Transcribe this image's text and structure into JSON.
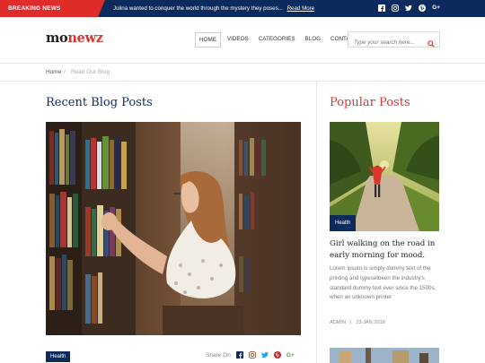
{
  "topbar": {
    "breaking_label": "BREAKING NEWS",
    "ticker_text": "Julina wanted to conquer the world through the mystery they poses...",
    "read_more": "Read More",
    "social_icons": [
      "facebook-icon",
      "instagram-icon",
      "twitter-icon",
      "pinterest-icon",
      "google-plus-icon"
    ],
    "gplus_label": "G+"
  },
  "header": {
    "logo_part1": "mo",
    "logo_part2": "newz",
    "nav": [
      "HOME",
      "VIDEOS",
      "CATEGORIES",
      "BLOG",
      "CONTACT"
    ],
    "active_nav": "HOME",
    "search_placeholder": "Type your search here..."
  },
  "breadcrumb": {
    "home": "Home",
    "separator": "/",
    "current": "Read Our Blog"
  },
  "main": {
    "section_title": "Recent Blog Posts",
    "post_tag": "Health",
    "share_label": "Share On"
  },
  "sidebar": {
    "title": "Popular Posts",
    "post": {
      "tag": "Health",
      "headline": "Girl walking on the road in early morning for mood.",
      "excerpt": "Lorem Ipsum is simply dummy text of the printing and typesetbeen the industry's standard dummy text ever since the 1500s, when an unknown printer",
      "author": "ADMIN",
      "meta_sep": "|",
      "date": "23 JAN 2018"
    }
  },
  "colors": {
    "navy": "#0c2a5b",
    "red": "#d33",
    "breaking_red": "#e02b2b"
  }
}
